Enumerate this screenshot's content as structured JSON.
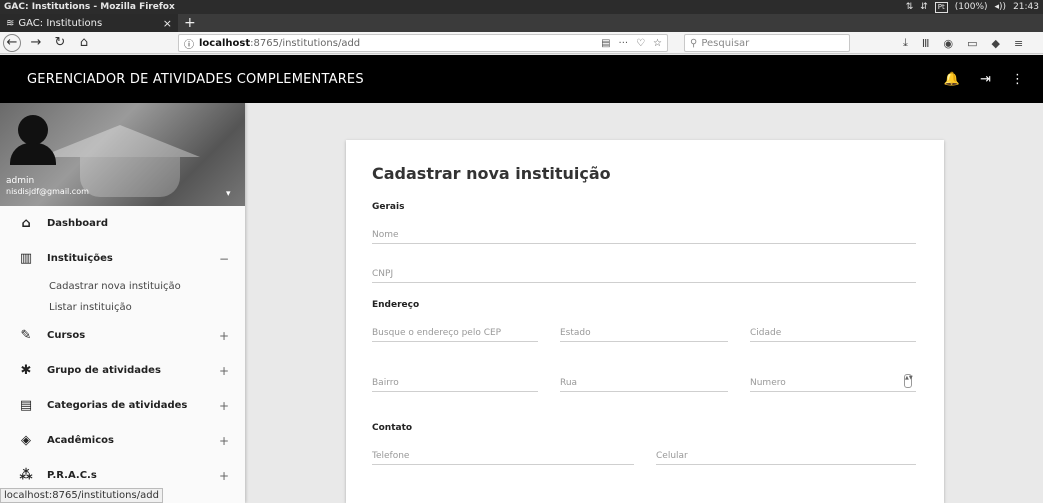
{
  "os": {
    "window_title": "GAC: Institutions - Mozilla Firefox",
    "tray": [
      "⇅",
      "⇵",
      "Pt",
      "(100%)",
      "◂))",
      "21:43"
    ]
  },
  "browser": {
    "tab_title": "GAC: Institutions",
    "tab_close": "×",
    "new_tab": "+",
    "url_info": "ⓘ",
    "url_host": "localhost",
    "url_path": ":8765/institutions/add",
    "url_actions": [
      "▤",
      "···",
      "♡",
      "☆"
    ],
    "search_placeholder": "Pesquisar",
    "toolbar_icons": [
      "⤓",
      "Ⅲ",
      "◉",
      "▭",
      "◆",
      "≡"
    ],
    "status_url": "localhost:8765/institutions/add"
  },
  "header": {
    "title": "GERENCIADOR DE ATIVIDADES COMPLEMENTARES",
    "bell": "🔔",
    "logout": "⇥",
    "more": "⋮"
  },
  "profile": {
    "name": "admin",
    "email": "nisdisjdf@gmail.com"
  },
  "sidebar": {
    "items": [
      {
        "label": "Dashboard",
        "icon": "⌂",
        "toggle": ""
      },
      {
        "label": "Instituições",
        "icon": "▥",
        "toggle": "−"
      },
      {
        "label": "Cursos",
        "icon": "✎",
        "toggle": "+"
      },
      {
        "label": "Grupo de atividades",
        "icon": "✱",
        "toggle": "+"
      },
      {
        "label": "Categorias de atividades",
        "icon": "▤",
        "toggle": "+"
      },
      {
        "label": "Acadêmicos",
        "icon": "◈",
        "toggle": "+"
      },
      {
        "label": "P.R.A.C.s",
        "icon": "⁂",
        "toggle": "+"
      }
    ],
    "sub_items": [
      "Cadastrar nova instituição",
      "Listar instituição"
    ]
  },
  "form": {
    "title": "Cadastrar nova instituição",
    "sections": {
      "gerais": "Gerais",
      "endereco": "Endereço",
      "contato": "Contato"
    },
    "fields": {
      "nome": "Nome",
      "cnpj": "CNPJ",
      "cep": "Busque o endereço pelo CEP",
      "estado": "Estado",
      "cidade": "Cidade",
      "bairro": "Bairro",
      "rua": "Rua",
      "numero": "Numero",
      "telefone": "Telefone",
      "celular": "Celular"
    }
  }
}
